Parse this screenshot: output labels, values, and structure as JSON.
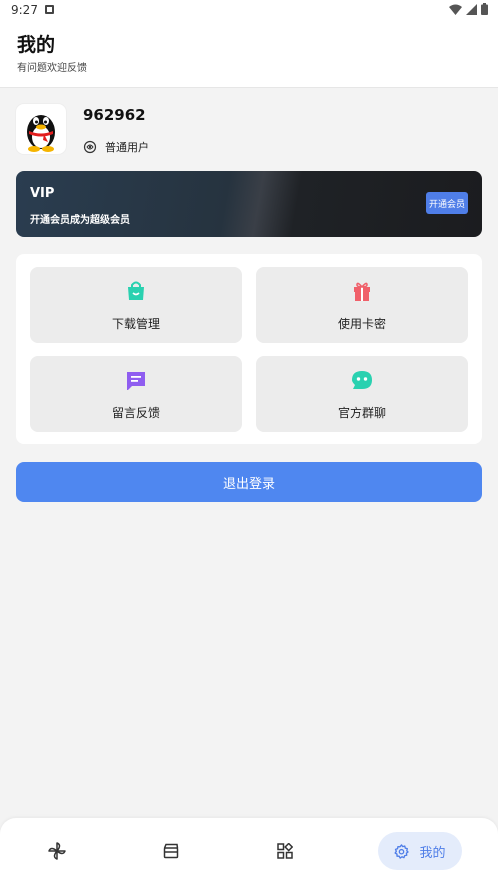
{
  "status_bar": {
    "time": "9:27"
  },
  "header": {
    "title": "我的",
    "subtitle": "有问题欢迎反馈"
  },
  "profile": {
    "username": "962962",
    "user_type": "普通用户"
  },
  "vip": {
    "title": "VIP",
    "description": "开通会员成为超级会员",
    "button_label": "开通会员"
  },
  "grid": {
    "items": [
      {
        "label": "下载管理",
        "icon": "download-bag-icon",
        "color": "#2ad1b0"
      },
      {
        "label": "使用卡密",
        "icon": "gift-icon",
        "color": "#f0606a"
      },
      {
        "label": "留言反馈",
        "icon": "message-icon",
        "color": "#8f5df0"
      },
      {
        "label": "官方群聊",
        "icon": "chat-bubble-icon",
        "color": "#2ad1b0"
      }
    ]
  },
  "logout": {
    "label": "退出登录"
  },
  "bottom_nav": {
    "active_label": "我的"
  },
  "colors": {
    "accent": "#4f87f0",
    "vip_button": "#4f7ee8"
  }
}
